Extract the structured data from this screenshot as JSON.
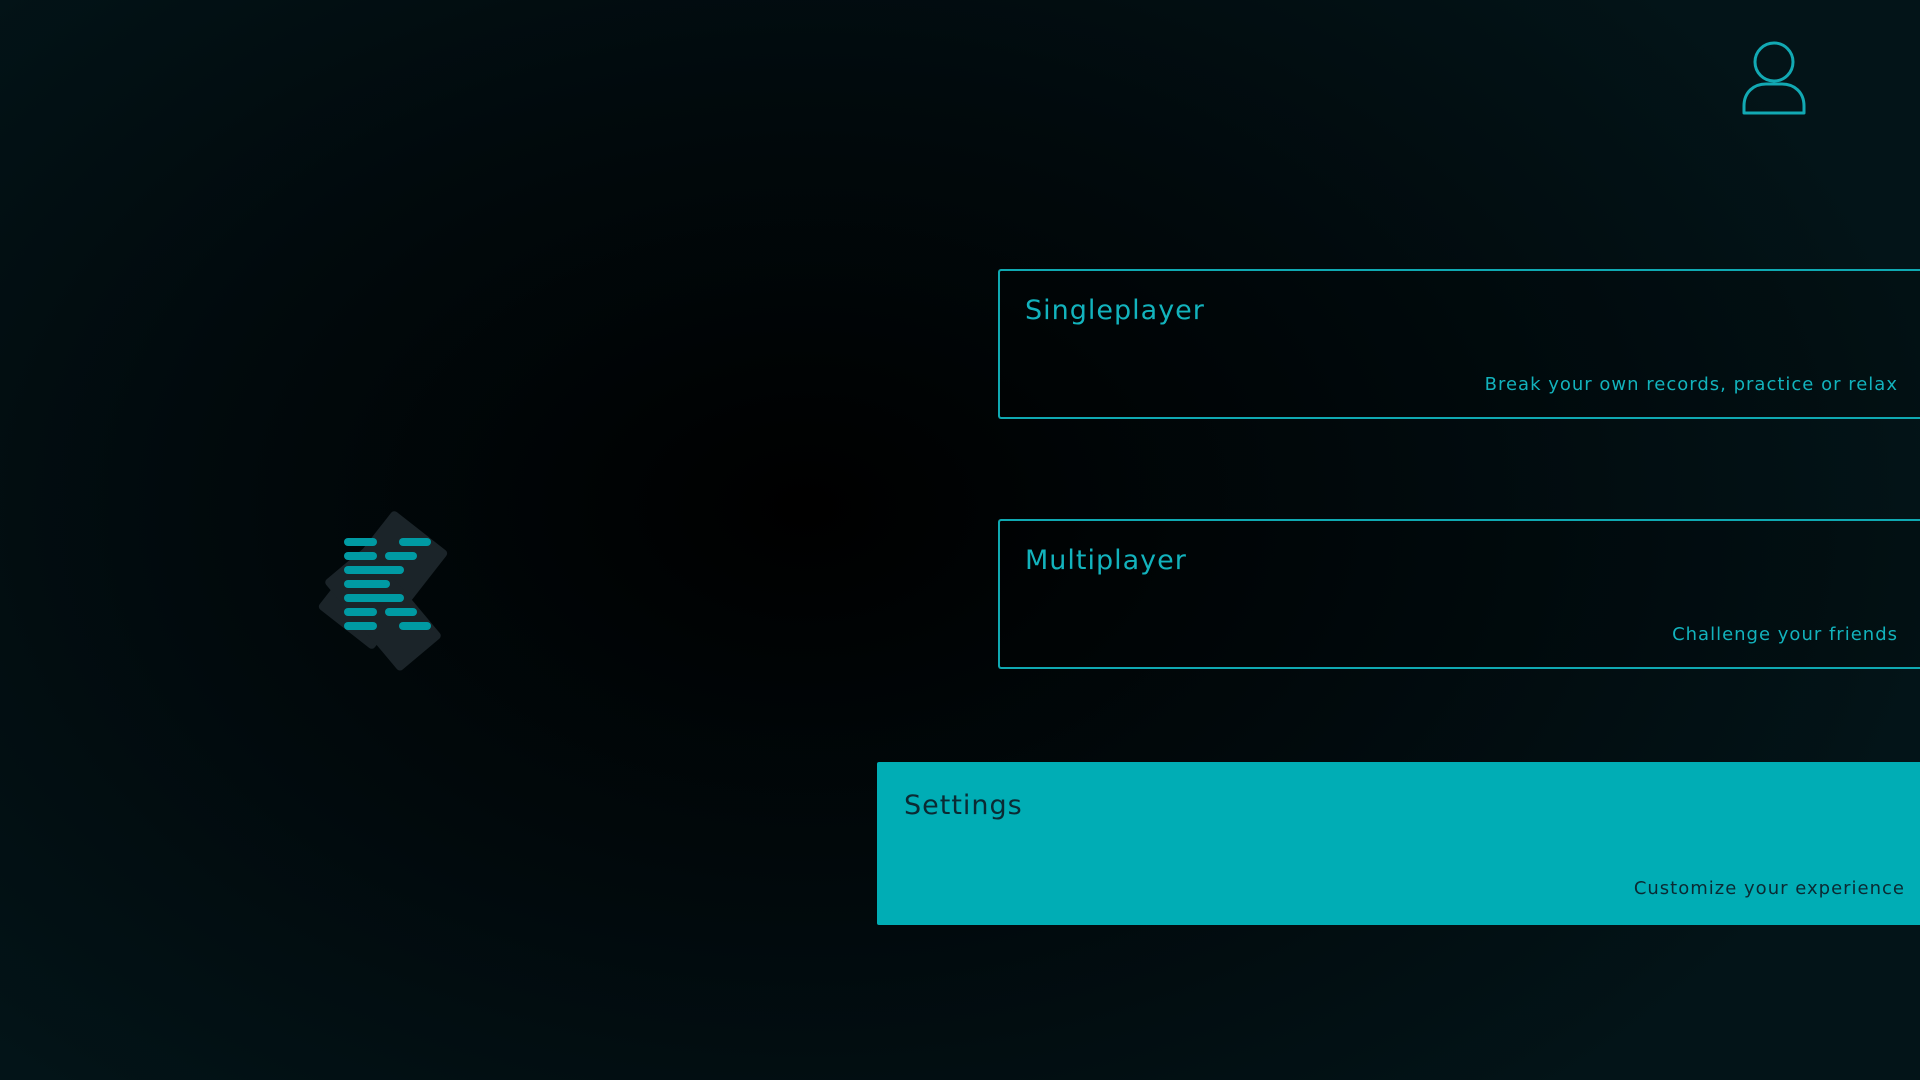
{
  "colors": {
    "accent": "#00adb5",
    "accent_text": "#12b3bd",
    "dark_text": "#0b2a33",
    "background": "#000000",
    "logo_tile": "#1b2429",
    "logo_bars": "#009aa3"
  },
  "header": {
    "profile_icon": "user-icon"
  },
  "logo": {
    "icon": "game-logo"
  },
  "menu": {
    "singleplayer": {
      "title": "Singleplayer",
      "subtitle": "Break your own records, practice or relax"
    },
    "multiplayer": {
      "title": "Multiplayer",
      "subtitle": "Challenge your friends"
    },
    "settings": {
      "title": "Settings",
      "subtitle": "Customize your experience",
      "selected": true
    }
  }
}
